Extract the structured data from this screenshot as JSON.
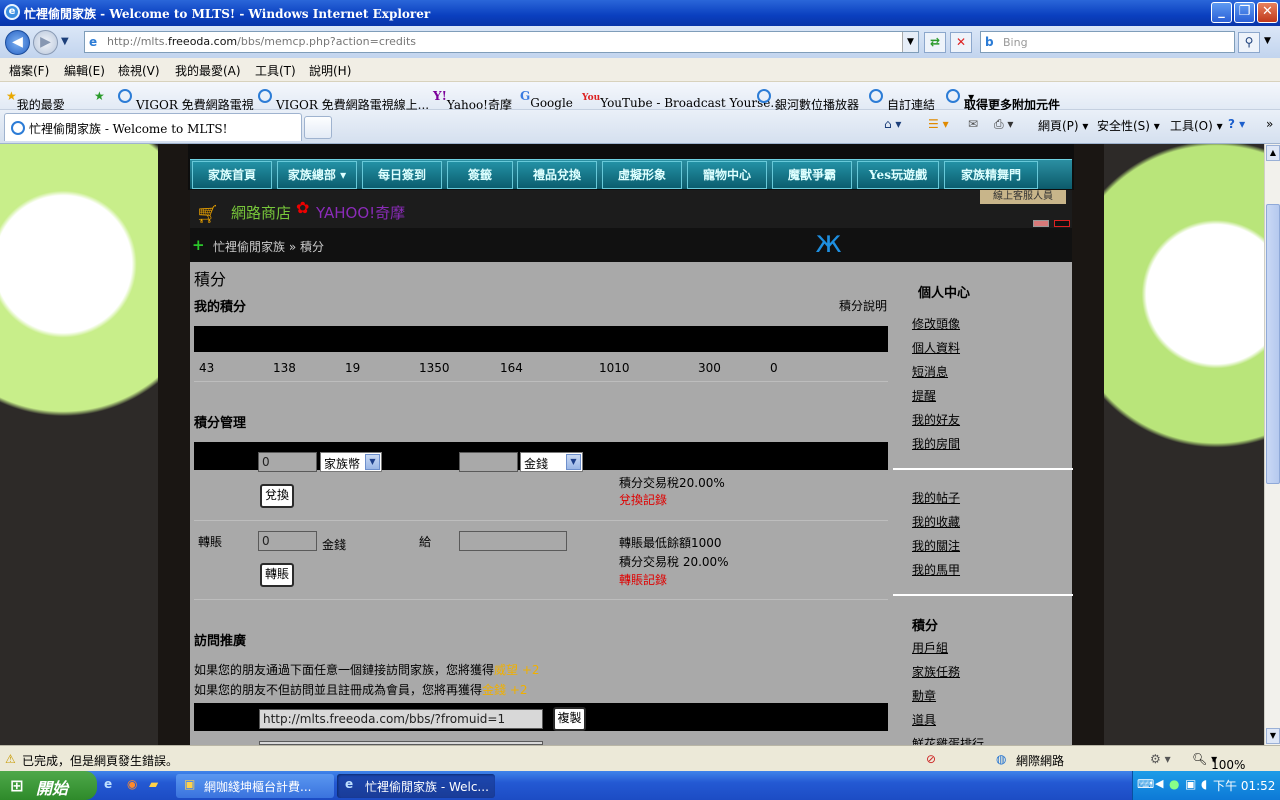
{
  "window": {
    "title": "忙裡偷閒家族 - Welcome to MLTS! - Windows Internet Explorer"
  },
  "address": {
    "url_prefix": "http://mlts.",
    "url_domain": "freeoda.com",
    "url_rest": "/bbs/memcp.php?action=credits",
    "search_placeholder": "Bing"
  },
  "menu": [
    "檔案(F)",
    "編輯(E)",
    "檢視(V)",
    "我的最愛(A)",
    "工具(T)",
    "說明(H)"
  ],
  "favorites": {
    "label": "我的最愛",
    "items": [
      "VIGOR 免費網路電視",
      "VIGOR 免費網路電視線上...",
      "Yahoo!奇摩",
      "Google",
      "YouTube - Broadcast Yourse...",
      "銀河數位播放器",
      "自訂連結",
      "取得更多附加元件"
    ]
  },
  "tab": {
    "title": "忙裡偷閒家族 - Welcome to MLTS!"
  },
  "commandbar": {
    "page": "網頁(P)",
    "safety": "安全性(S)",
    "tools": "工具(O)"
  },
  "site_nav": [
    "家族首頁",
    "家族總部",
    "每日簽到",
    "簽籤",
    "禮品兌換",
    "虛擬形象",
    "寵物中心",
    "魔獸爭霸",
    "Yes玩遊戲",
    "家族精舞門"
  ],
  "shop": {
    "label": "網路商店",
    "yahoo": "YAHOO!奇摩",
    "online_service": "線上客服人員"
  },
  "breadcrumb": {
    "home": "忙裡偷閒家族",
    "sep": "»",
    "current": "積分"
  },
  "main": {
    "page_title": "積分",
    "my_credits": {
      "heading": "我的積分",
      "help_link": "積分說明",
      "values": [
        "43",
        "138",
        "19",
        "1350",
        "164",
        "1010",
        "300",
        "0"
      ]
    },
    "manage": {
      "heading": "積分管理",
      "exchange": {
        "amount": "0",
        "from_currency": "家族幣",
        "to_currency": "金錢",
        "button": "兌換",
        "tax": "積分交易稅20.00%",
        "record": "兌換記錄"
      },
      "transfer": {
        "label": "轉賬",
        "amount": "0",
        "currency": "金錢",
        "to_label": "給",
        "min_balance": "轉賬最低餘額1000",
        "tax": "積分交易稅 20.00%",
        "button": "轉賬",
        "record": "轉賬記錄"
      }
    },
    "referral": {
      "heading": "訪問推廣",
      "line1": "如果您的朋友通過下面任意一個鏈接訪問家族，您將獲得",
      "bonus1": "威望 +2",
      "line2": "如果您的朋友不但訪問並且註冊成為會員，您將再獲得",
      "bonus2": "金錢 +2",
      "link": "http://mlts.freeoda.com/bbs/?fromuid=1",
      "copy_button": "複製"
    }
  },
  "sidebar": {
    "title": "個人中心",
    "group1": [
      "修改頭像",
      "個人資料",
      "短消息",
      "提醒",
      "我的好友",
      "我的房間"
    ],
    "group2": [
      "我的帖子",
      "我的收藏",
      "我的關注",
      "我的馬甲"
    ],
    "group3_title": "積分",
    "group3": [
      "用戶組",
      "家族任務",
      "勳章",
      "道具",
      "鮮花雞蛋排行"
    ]
  },
  "status": {
    "text": "已完成，但是網頁發生錯誤。",
    "zone": "網際網路",
    "zoom": "100%"
  },
  "taskbar": {
    "start": "開始",
    "task1": "網咖綫坤櫃台計費...",
    "task2": "忙裡偷閒家族 - Welc...",
    "clock": "下午 01:52"
  }
}
